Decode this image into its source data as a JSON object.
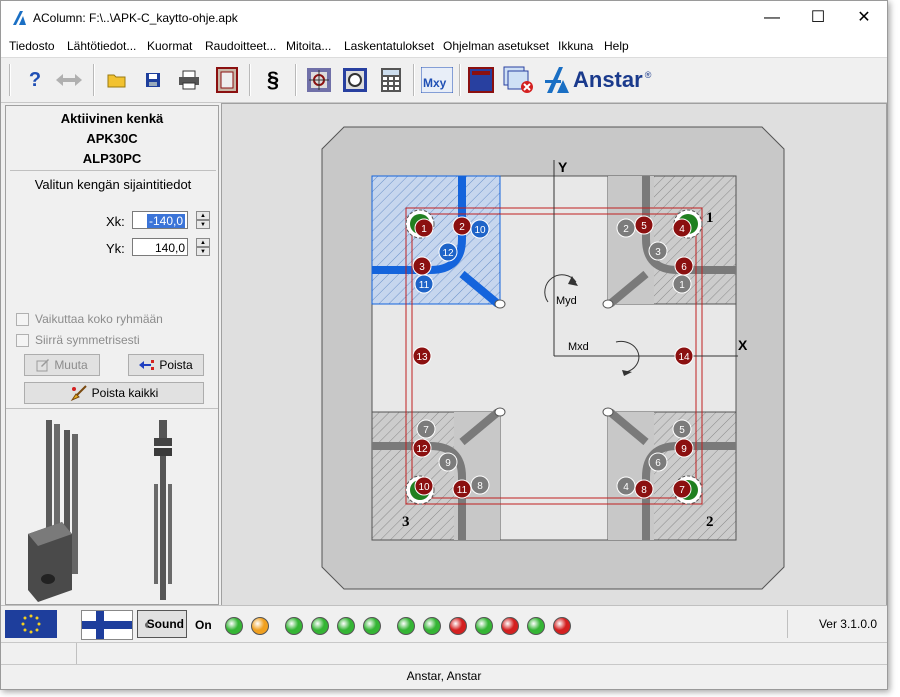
{
  "window": {
    "title": "AColumn:  F:\\..\\APK-C_kaytto-ohje.apk",
    "minimize_glyph": "—",
    "maximize_glyph": "☐",
    "close_glyph": "✕"
  },
  "menu": [
    "Tiedosto",
    "Lähtötiedot...",
    "Kuormat",
    "Raudoitteet...",
    "Mitoita...",
    "Laskentatulokset",
    "Ohjelman asetukset",
    "Ikkuna",
    "Help"
  ],
  "toolbar": {
    "help_glyph": "?",
    "section_glyph": "§",
    "mxy_label": "Mxy",
    "brand": "Anstar",
    "brand_mark": "®"
  },
  "shoe": {
    "heading": "Aktiivinen kenkä",
    "type1": "APK30C",
    "type2": "ALP30PC",
    "position_heading": "Valitun kengän sijaintitiedot",
    "xk_label": "Xk:",
    "xk_value": "-140,0",
    "yk_label": "Yk:",
    "yk_value": "140,0",
    "affect_group": "Vaikuttaa koko ryhmään",
    "move_symmetric": "Siirrä symmetrisesti",
    "btn_change": "Muuta",
    "btn_remove": "Poista",
    "btn_remove_all": "Poista kaikki"
  },
  "drawing": {
    "axis_x": "X",
    "axis_y": "Y",
    "moment_y": "Myd",
    "moment_x": "Mxd",
    "corners": [
      "1",
      "2",
      "3"
    ],
    "bolts": [
      {
        "n": "1",
        "color": "#8b1010"
      },
      {
        "n": "2",
        "color": "#7c7c7c"
      },
      {
        "n": "3",
        "color": "#8b1010"
      },
      {
        "n": "4",
        "color": "#8b1010"
      },
      {
        "n": "5",
        "color": "#8b1010"
      },
      {
        "n": "6",
        "color": "#8b1010"
      },
      {
        "n": "7",
        "color": "#8b1010"
      },
      {
        "n": "8",
        "color": "#8b1010"
      },
      {
        "n": "9",
        "color": "#8b1010"
      },
      {
        "n": "10",
        "color": "#8b1010"
      },
      {
        "n": "11",
        "color": "#8b1010"
      },
      {
        "n": "12",
        "color": "#8b1010"
      },
      {
        "n": "13",
        "color": "#8b1010"
      },
      {
        "n": "14",
        "color": "#8b1010"
      }
    ]
  },
  "status": {
    "sound_label": "Sound",
    "sound_state": "On",
    "leds": [
      "green",
      "orange",
      "green",
      "green",
      "green",
      "green",
      "green",
      "green",
      "red",
      "green",
      "red",
      "green",
      "red"
    ],
    "version": "Ver 3.1.0.0",
    "footer": "Anstar,  Anstar"
  },
  "colors": {
    "led_green": "#35b535",
    "led_orange": "#f0a020",
    "led_red": "#d42020",
    "bolt_red": "#8b1010",
    "bolt_grey": "#7c7c7c",
    "bolt_blue": "#1e64c8",
    "active_blue": "#1464dc"
  }
}
